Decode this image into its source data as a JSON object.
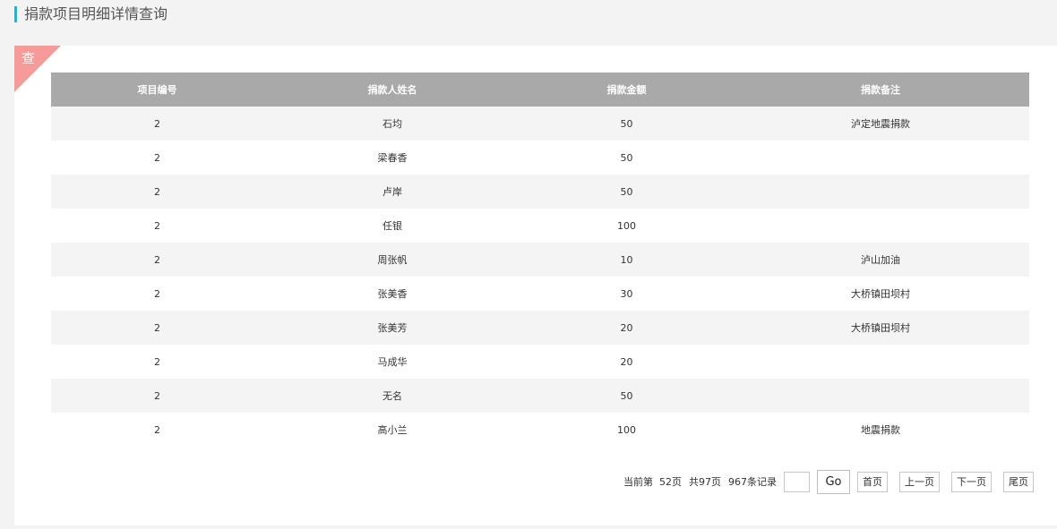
{
  "header": {
    "title": "捐款项目明细详情查询",
    "accent_color": "#1fb5d0"
  },
  "panel": {
    "corner_label": "查",
    "corner_color": "#f79a9a"
  },
  "table": {
    "header_bg": "#a9a9a9",
    "columns": [
      "项目编号",
      "捐款人姓名",
      "捐款金额",
      "捐款备注"
    ],
    "rows": [
      [
        "2",
        "石均",
        "50",
        "泸定地震捐款"
      ],
      [
        "2",
        "梁春香",
        "50",
        ""
      ],
      [
        "2",
        "卢岸",
        "50",
        ""
      ],
      [
        "2",
        "任银",
        "100",
        ""
      ],
      [
        "2",
        "周张帆",
        "10",
        "泸山加油"
      ],
      [
        "2",
        "张美香",
        "30",
        "大桥镇田坝村"
      ],
      [
        "2",
        "张美芳",
        "20",
        "大桥镇田坝村"
      ],
      [
        "2",
        "马成华",
        "20",
        ""
      ],
      [
        "2",
        "无名",
        "50",
        ""
      ],
      [
        "2",
        "高小兰",
        "100",
        "地震捐款"
      ]
    ]
  },
  "pager": {
    "current_page_text": "当前第  52页",
    "total_pages_text": "共97页",
    "total_records_text": "967条记录",
    "page_input_value": "",
    "go_label": "Go",
    "first_label": "首页",
    "prev_label": "上一页",
    "next_label": "下一页",
    "last_label": "尾页"
  }
}
